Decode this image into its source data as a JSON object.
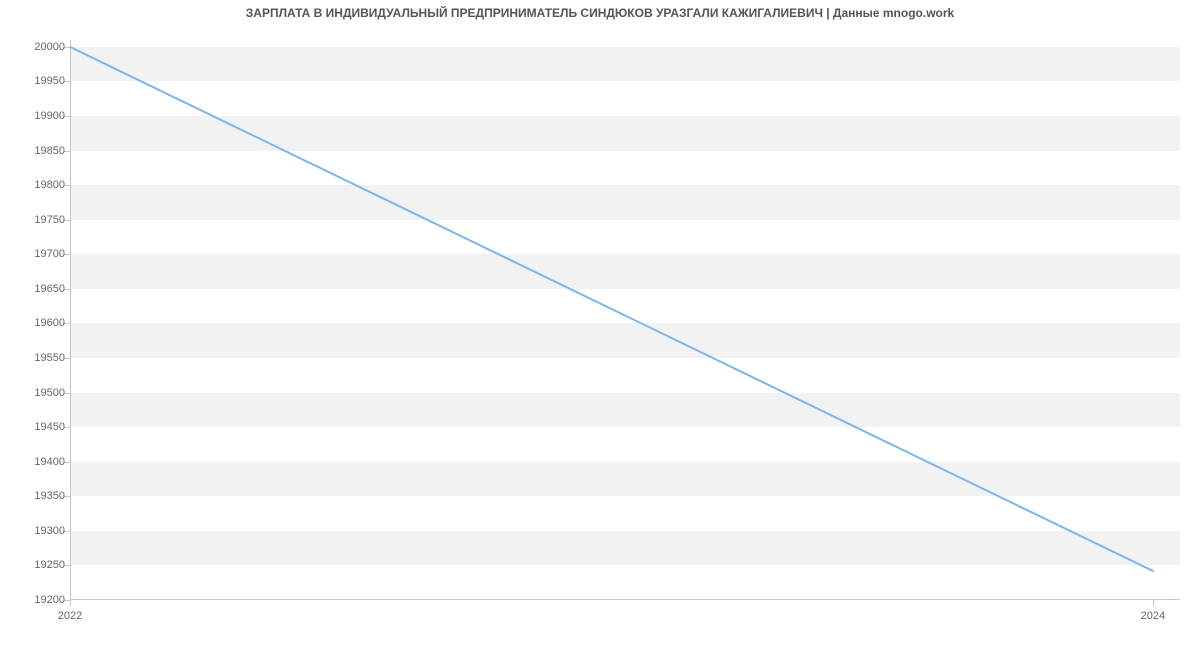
{
  "chart_data": {
    "type": "line",
    "title": "ЗАРПЛАТА В ИНДИВИДУАЛЬНЫЙ ПРЕДПРИНИМАТЕЛЬ СИНДЮКОВ УРАЗГАЛИ КАЖИГАЛИЕВИЧ | Данные mnogo.work",
    "xlabel": "",
    "ylabel": "",
    "x": [
      2022,
      2024
    ],
    "values": [
      20000,
      19242
    ],
    "x_ticks": [
      2022,
      2024
    ],
    "y_ticks": [
      19200,
      19250,
      19300,
      19350,
      19400,
      19450,
      19500,
      19550,
      19600,
      19650,
      19700,
      19750,
      19800,
      19850,
      19900,
      19950,
      20000
    ],
    "xlim": [
      2022,
      2024.05
    ],
    "ylim": [
      19200,
      20010
    ],
    "line_color": "#7cb5ec",
    "band_color": "#f2f2f2",
    "grid": false
  }
}
